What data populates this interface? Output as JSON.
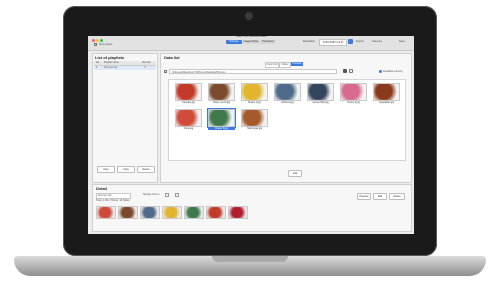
{
  "window": {
    "title": "Tipard Photo Slideshow Maker",
    "project_label": "New project"
  },
  "toolbar": {
    "modes": [
      "Pictures",
      "Images/Video",
      "Transitions"
    ],
    "resolution_label": "Resolution",
    "resolution_value": "1920x1080 (16:9)",
    "export_label": "Export",
    "save_as_label": "Save As",
    "save_label": "Save"
  },
  "left_panel": {
    "title": "List of playlists",
    "columns": [
      "No.",
      "Playlist name",
      "Number"
    ],
    "rows": [
      {
        "no": "1",
        "name": "Summer trip",
        "number": "3"
      }
    ],
    "buttons": [
      "New",
      "Copy",
      "Delete"
    ]
  },
  "data_list": {
    "title": "Data list",
    "view_tabs": [
      "Import list",
      "Folder",
      "Preview"
    ],
    "path": "/Volumes/Macintosh HD/Users/Desktop/Pictures",
    "available_memory": "Available memory",
    "photos": [
      {
        "caption": "Pancake.jpg",
        "color": "#c23a2a"
      },
      {
        "caption": "Pastry Lunch.jpg",
        "color": "#7b4a2c"
      },
      {
        "caption": "Flower 1.jpg",
        "color": "#e3b52d"
      },
      {
        "caption": "Workout.jpg",
        "color": "#4f6a8a"
      },
      {
        "caption": "Sunset Hike.jpg",
        "color": "#33465e"
      },
      {
        "caption": "Flower 2.jpg",
        "color": "#d86a8e"
      },
      {
        "caption": "Vegetables.jpg",
        "color": "#8a3a1c"
      },
      {
        "caption": "Fruits.jpg",
        "color": "#d14b3b"
      },
      {
        "caption": "Flower 3.jpg",
        "color": "#3f7a4c"
      },
      {
        "caption": "Hamburger.jpg",
        "color": "#a55a2a"
      }
    ],
    "selected_index": 8,
    "add_button": "Add"
  },
  "detail": {
    "title": "Detail",
    "name_label": "Summer trip",
    "sample_label": "Sample how to",
    "duration": "Total: 1 Min. Photos: 10 Slides",
    "strip_colors": [
      "#d14b3b",
      "#7b4a2c",
      "#4f6a8a",
      "#e3b52d",
      "#3f7a4c",
      "#c23a2a",
      "#b01f2f"
    ],
    "actions": [
      "Preview",
      "Edit",
      "Delete"
    ]
  }
}
